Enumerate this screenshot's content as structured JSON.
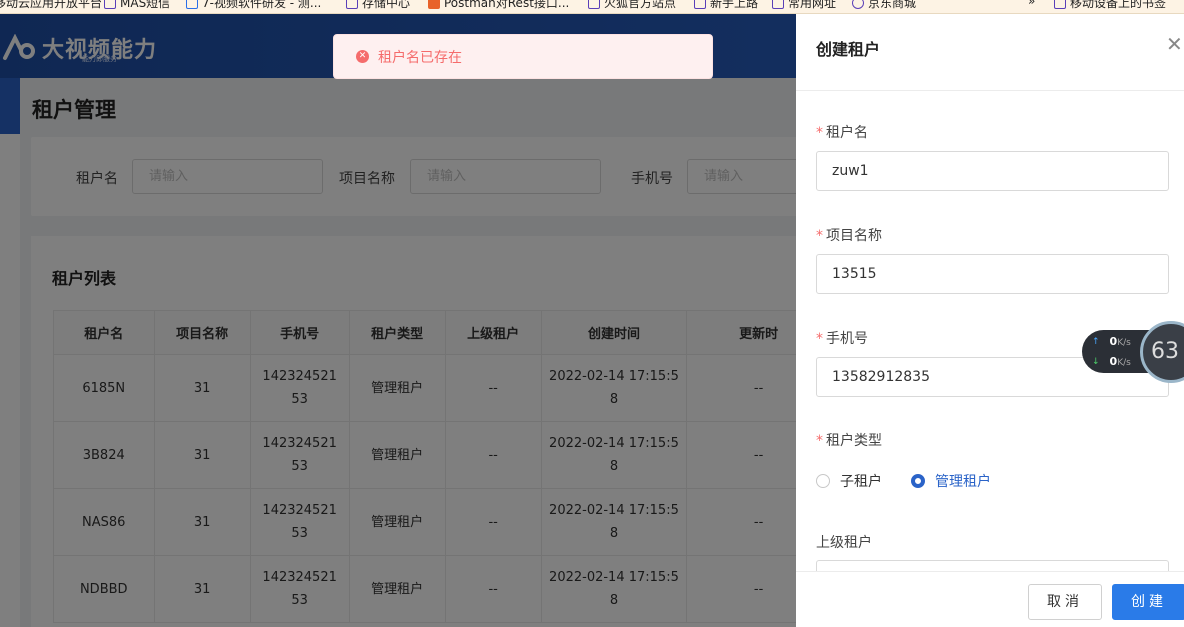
{
  "bookmarks": [
    {
      "label": "移动云应用开放平台",
      "icon": "folder-icon"
    },
    {
      "label": "MAS短信",
      "icon": "folder-icon"
    },
    {
      "label": "7-视频软件研发 - 测...",
      "icon": "user-icon"
    },
    {
      "label": "存储中心",
      "icon": "folder-icon"
    },
    {
      "label": "Postman对Rest接口...",
      "icon": "c-icon"
    },
    {
      "label": "火狐官方站点",
      "icon": "folder-icon"
    },
    {
      "label": "新手上路",
      "icon": "folder-icon"
    },
    {
      "label": "常用网址",
      "icon": "folder-icon"
    },
    {
      "label": "京东商城",
      "icon": "globe-icon"
    },
    {
      "label": "移动设备上的书签",
      "icon": "folder-icon"
    }
  ],
  "header": {
    "logo_title": "大视频能力",
    "logo_subtitle": "能力即服务"
  },
  "page": {
    "title": "租户管理"
  },
  "filters": {
    "tenant_name_label": "租户名",
    "tenant_name_placeholder": "请输入",
    "project_name_label": "项目名称",
    "project_name_placeholder": "请输入",
    "phone_label": "手机号",
    "phone_placeholder": "请输入"
  },
  "list": {
    "title": "租户列表",
    "columns": [
      "租户名",
      "项目名称",
      "手机号",
      "租户类型",
      "上级租户",
      "创建时间",
      "更新时"
    ],
    "rows": [
      {
        "name": "6185N",
        "project": "31",
        "phone_l1": "142324521",
        "phone_l2": "53",
        "type": "管理租户",
        "parent": "--",
        "created_l1": "2022-02-14 17:15:5",
        "created_l2": "8",
        "updated": "--"
      },
      {
        "name": "3B824",
        "project": "31",
        "phone_l1": "142324521",
        "phone_l2": "53",
        "type": "管理租户",
        "parent": "--",
        "created_l1": "2022-02-14 17:15:5",
        "created_l2": "8",
        "updated": "--"
      },
      {
        "name": "NAS86",
        "project": "31",
        "phone_l1": "142324521",
        "phone_l2": "53",
        "type": "管理租户",
        "parent": "--",
        "created_l1": "2022-02-14 17:15:5",
        "created_l2": "8",
        "updated": "--"
      },
      {
        "name": "NDBBD",
        "project": "31",
        "phone_l1": "142324521",
        "phone_l2": "53",
        "type": "管理租户",
        "parent": "--",
        "created_l1": "2022-02-14 17:15:5",
        "created_l2": "8",
        "updated": "--"
      }
    ]
  },
  "toast": {
    "message": "租户名已存在",
    "icon": "error-circle-icon",
    "color": "#f56c6c"
  },
  "drawer": {
    "title": "创建租户",
    "fields": {
      "tenant_name_label": "租户名",
      "tenant_name_value": "zuw1",
      "project_name_label": "项目名称",
      "project_name_value": "13515",
      "phone_label": "手机号",
      "phone_value": "13582912835",
      "tenant_type_label": "租户类型",
      "type_option_sub": "子租户",
      "type_option_admin": "管理租户",
      "parent_label": "上级租户"
    },
    "cancel_label": "取消",
    "create_label": "创建"
  },
  "net_widget": {
    "up_value": "0",
    "up_unit": "K/s",
    "down_value": "0",
    "down_unit": "K/s",
    "percent": "63"
  },
  "colors": {
    "accent": "#2a63c8",
    "error": "#f56c6c",
    "primary_button": "#2a7be8"
  }
}
